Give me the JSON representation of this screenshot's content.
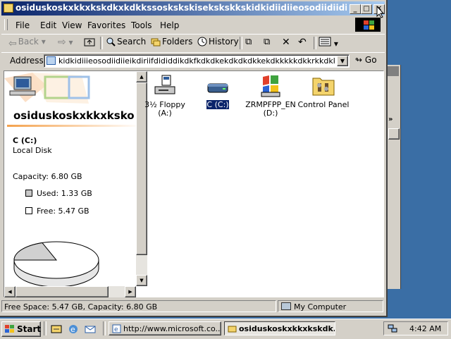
{
  "window": {
    "title": "osiduskoskxkkxkskdkxkdkkssoskskskisekskskkskidkidiidiieosodiidiidiieikdiriifdidiiddikdkfkdkdk",
    "minimize_glyph": "_",
    "maximize_glyph": "□",
    "close_glyph": "✕"
  },
  "menu": [
    "File",
    "Edit",
    "View",
    "Favorites",
    "Tools",
    "Help"
  ],
  "toolbar": {
    "back": "Back",
    "search": "Search",
    "folders": "Folders",
    "history": "History"
  },
  "address": {
    "label": "Address",
    "value": "kidkidiiieosodiidiieikdiriifdididdikdkfkdkdkekdkdkdkkekdkkkkkdkkrkkdkkkrkrodkrkdkdkdk",
    "go": "Go"
  },
  "left_pane": {
    "title": "osiduskoskxkkxksko",
    "drive_name": "C (C:)",
    "drive_type": "Local Disk",
    "capacity": "Capacity: 6.80 GB",
    "used": "Used: 1.33 GB",
    "free": "Free: 5.47 GB",
    "used_fraction": 0.196
  },
  "items": [
    {
      "label_line1": "3½ Floppy",
      "label_line2": "(A:)",
      "icon": "floppy-drive-icon"
    },
    {
      "label_line1": "C (C:)",
      "label_line2": "",
      "icon": "hard-disk-icon",
      "selected": true
    },
    {
      "label_line1": "ZRMPFPP_EN",
      "label_line2": "(D:)",
      "icon": "cd-drive-icon"
    },
    {
      "label_line1": "Control Panel",
      "label_line2": "",
      "icon": "control-panel-icon"
    }
  ],
  "status": {
    "left": "Free Space: 5.47 GB, Capacity: 6.80 GB",
    "right": "My Computer"
  },
  "taskbar": {
    "start": "Start",
    "tasks": [
      {
        "label": "http://www.microsoft.co...",
        "active": false
      },
      {
        "label": "osiduskoskxkkxkskdk...",
        "active": true
      }
    ],
    "clock": "4:42 AM"
  },
  "bg_window": {
    "chevron": "»"
  },
  "colors": {
    "desktop": "#3a6ea5",
    "face": "#d4d0c8",
    "title_start": "#0a246a",
    "title_end": "#a6caf0",
    "selection": "#0a246a"
  }
}
